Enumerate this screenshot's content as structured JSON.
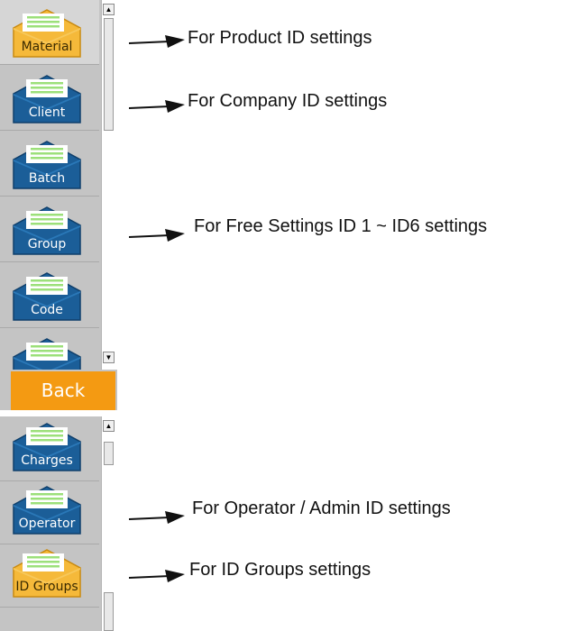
{
  "top_menu": {
    "items": [
      {
        "label": "Material",
        "active": true
      },
      {
        "label": "Client",
        "active": false
      },
      {
        "label": "Batch",
        "active": false
      },
      {
        "label": "Group",
        "active": false
      },
      {
        "label": "Code",
        "active": false
      },
      {
        "label": "",
        "active": false
      }
    ],
    "back_label": "Back"
  },
  "bottom_menu": {
    "items": [
      {
        "label": "Charges"
      },
      {
        "label": "Operator"
      },
      {
        "label": "ID Groups"
      }
    ]
  },
  "annotations": {
    "product_bold": "For Product ID",
    "product_rest": " settings",
    "company": "For Company ID settings",
    "free": "For Free Settings ID 1 ~ ID6 settings",
    "operator": "For Operator / Admin ID settings",
    "groups": "For ID Groups settings"
  },
  "colors": {
    "envelope_blue": "#1b5e98",
    "envelope_active": "#f5b93a",
    "back_button": "#f49a12"
  }
}
